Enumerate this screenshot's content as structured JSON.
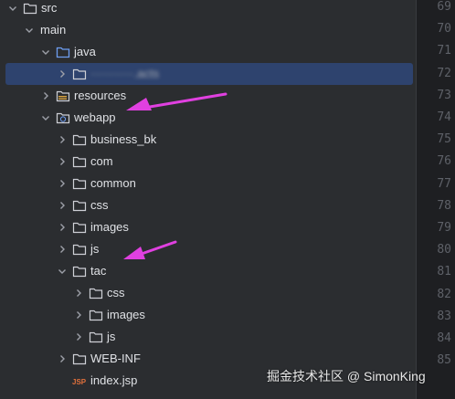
{
  "tree": [
    {
      "label": "src",
      "icon": "folder",
      "chevron": "down"
    },
    {
      "label": "main",
      "icon": "none",
      "chevron": "down"
    },
    {
      "label": "java",
      "icon": "source-folder",
      "chevron": "down"
    },
    {
      "label": "···········.acts",
      "icon": "package",
      "chevron": "right",
      "selected": true,
      "blurred": true
    },
    {
      "label": "resources",
      "icon": "resources-folder",
      "chevron": "right"
    },
    {
      "label": "webapp",
      "icon": "web-folder",
      "chevron": "down"
    },
    {
      "label": "business_bk",
      "icon": "folder",
      "chevron": "right"
    },
    {
      "label": "com",
      "icon": "folder",
      "chevron": "right"
    },
    {
      "label": "common",
      "icon": "folder",
      "chevron": "right"
    },
    {
      "label": "css",
      "icon": "folder",
      "chevron": "right"
    },
    {
      "label": "images",
      "icon": "folder",
      "chevron": "right"
    },
    {
      "label": "js",
      "icon": "folder",
      "chevron": "right"
    },
    {
      "label": "tac",
      "icon": "folder",
      "chevron": "down"
    },
    {
      "label": "css",
      "icon": "folder",
      "chevron": "right"
    },
    {
      "label": "images",
      "icon": "folder",
      "chevron": "right"
    },
    {
      "label": "js",
      "icon": "folder",
      "chevron": "right"
    },
    {
      "label": "WEB-INF",
      "icon": "folder",
      "chevron": "right"
    },
    {
      "label": "index.jsp",
      "icon": "jsp-file",
      "chevron": "none"
    }
  ],
  "line_numbers": [
    "69",
    "70",
    "71",
    "72",
    "73",
    "74",
    "75",
    "76",
    "77",
    "78",
    "79",
    "80",
    "81",
    "82",
    "83",
    "84",
    "85"
  ],
  "watermark": "掘金技术社区 @ SimonKing",
  "colors": {
    "background": "#2b2d30",
    "selection": "#2e436e",
    "arrow": "#e040e0",
    "text": "#dfe1e5",
    "gutter_text": "#5e6168"
  }
}
